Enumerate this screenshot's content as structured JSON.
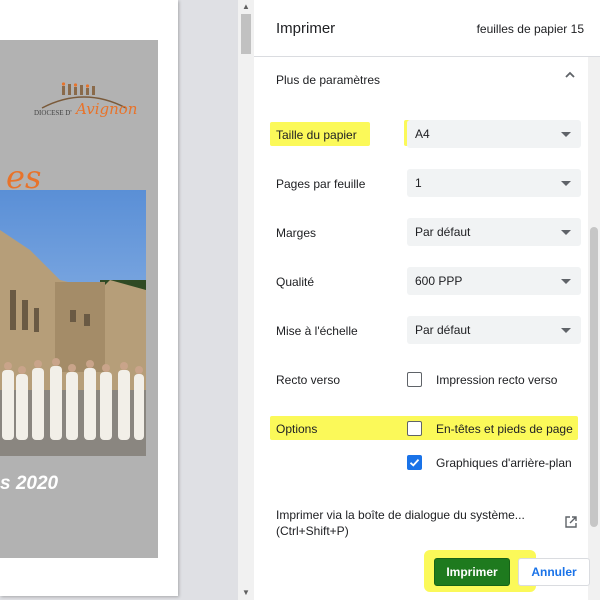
{
  "preview": {
    "logo_caption": "DIOCESE D'",
    "logo_script": "Avignon",
    "partial_title": "es",
    "partial_year": "s 2020"
  },
  "header": {
    "title": "Imprimer",
    "sheet_count": "feuilles de papier 15"
  },
  "settings": {
    "more_label": "Plus de paramètres",
    "paper_size": {
      "label": "Taille du papier",
      "value": "A4"
    },
    "pages_per_sheet": {
      "label": "Pages par feuille",
      "value": "1"
    },
    "margins": {
      "label": "Marges",
      "value": "Par défaut"
    },
    "quality": {
      "label": "Qualité",
      "value": "600 PPP"
    },
    "scaling": {
      "label": "Mise à l'échelle",
      "value": "Par défaut"
    },
    "duplex": {
      "label": "Recto verso",
      "checkbox_label": "Impression recto verso",
      "checked": false
    },
    "options": {
      "label": "Options",
      "headers_footers": {
        "label": "En-têtes et pieds de page",
        "checked": false
      },
      "background_graphics": {
        "label": "Graphiques d'arrière-plan",
        "checked": true
      }
    },
    "system_dialog_line1": "Imprimer via la boîte de dialogue du système...",
    "system_dialog_line2": "(Ctrl+Shift+P)"
  },
  "actions": {
    "print_label": "Imprimer",
    "cancel_label": "Annuler"
  },
  "colors": {
    "accent": "#1a73e8",
    "highlight": "#faf83c",
    "print_button": "#1e7a1e",
    "brand_orange": "#e8732a"
  }
}
